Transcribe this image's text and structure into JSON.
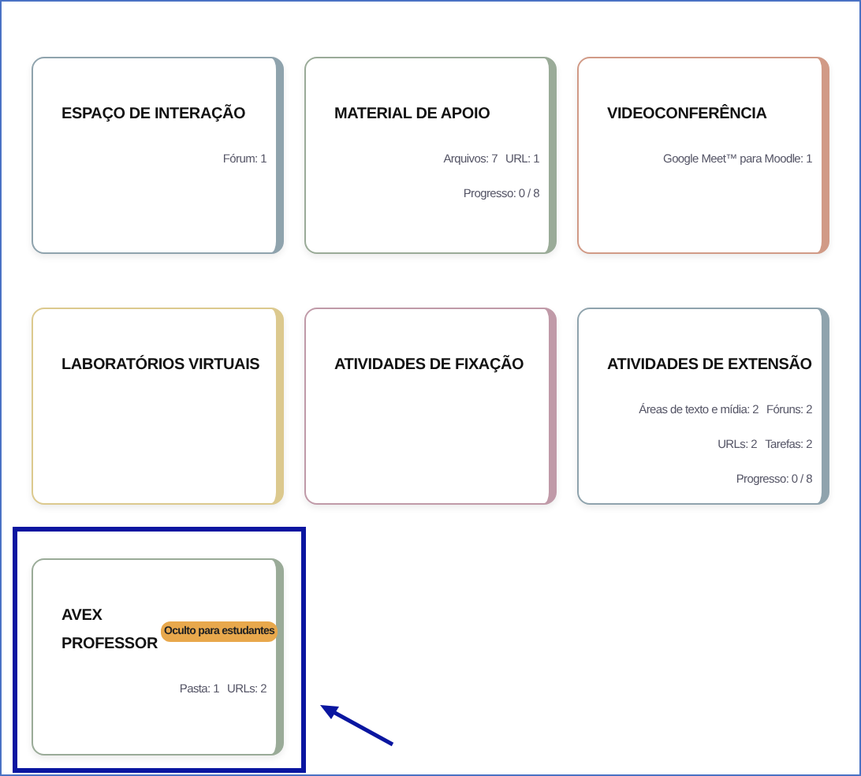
{
  "cards": [
    {
      "title": "ESPAÇO DE INTERAÇÃO",
      "color": "#8fa3ad",
      "stats": [
        [
          "Fórum: 1"
        ]
      ],
      "highlighted": false
    },
    {
      "title": "MATERIAL DE APOIO",
      "color": "#9aab98",
      "stats": [
        [
          "Arquivos: 7",
          "URL: 1"
        ],
        [
          "Progresso: 0 / 8"
        ]
      ],
      "highlighted": false
    },
    {
      "title": "VIDEOCONFERÊNCIA",
      "color": "#d19a86",
      "stats": [
        [
          "Google Meet™ para Moodle: 1"
        ]
      ],
      "highlighted": false
    },
    {
      "title": "LABORATÓRIOS VIRTUAIS",
      "color": "#dcc98e",
      "highlighted": false
    },
    {
      "title": "ATIVIDADES DE FIXAÇÃO",
      "color": "#c09aa8",
      "highlighted": false
    },
    {
      "title": "ATIVIDADES DE EXTENSÃO",
      "color": "#8fa3ad",
      "stats": [
        [
          "Áreas de texto e mídia: 2",
          "Fóruns: 2"
        ],
        [
          "URLs: 2",
          "Tarefas: 2"
        ],
        [
          "Progresso: 0 / 8"
        ]
      ],
      "highlighted": false
    },
    {
      "title": "AVEX PROFESSOR",
      "color": "#9aab98",
      "badge": "Oculto para estudantes",
      "stats": [
        [
          "Pasta: 1",
          "URLs: 2"
        ]
      ],
      "highlighted": true
    }
  ]
}
